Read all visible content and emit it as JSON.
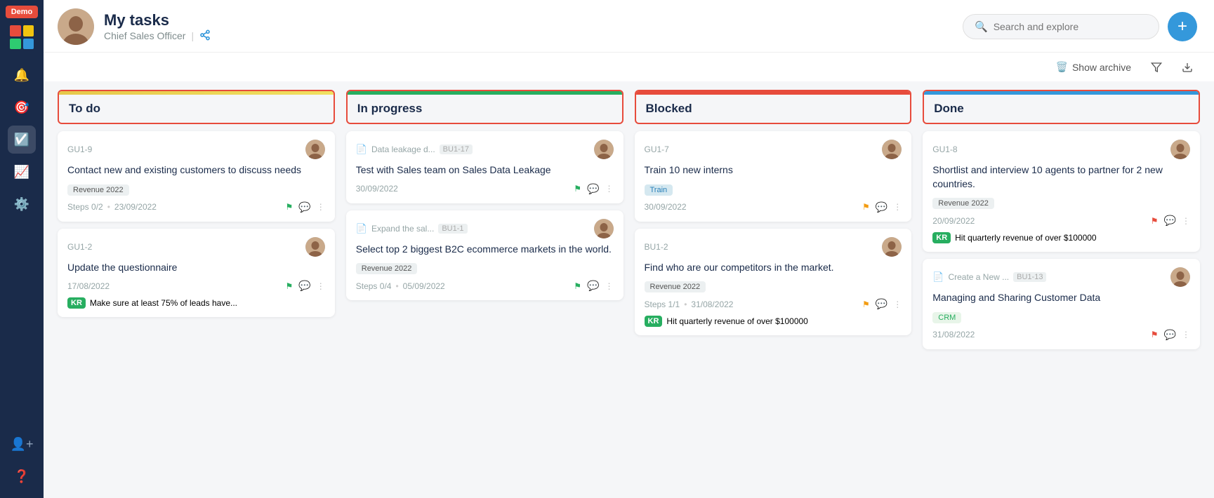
{
  "demo": {
    "label": "Demo"
  },
  "header": {
    "title": "My tasks",
    "subtitle": "Chief Sales Officer",
    "share_label": "share"
  },
  "toolbar": {
    "archive_label": "Show archive",
    "filter_label": "filter",
    "download_label": "download"
  },
  "search": {
    "placeholder": "Search and explore"
  },
  "add_btn": "+",
  "columns": [
    {
      "id": "todo",
      "title": "To do",
      "bar_class": "bar-yellow",
      "cards": [
        {
          "id": "GU1-9",
          "prefix": "",
          "mid": "",
          "title": "Contact new and existing customers to discuss needs",
          "tag": "Revenue 2022",
          "tag_class": "",
          "steps": "Steps 0/2",
          "date": "23/09/2022",
          "flag_class": "flag-green",
          "sub": null
        },
        {
          "id": "GU1-2",
          "prefix": "",
          "mid": "",
          "title": "Update the questionnaire",
          "tag": "",
          "tag_class": "",
          "steps": "",
          "date": "17/08/2022",
          "flag_class": "flag-green",
          "sub": "Make sure at least 75% of leads have..."
        }
      ]
    },
    {
      "id": "inprogress",
      "title": "In progress",
      "bar_class": "bar-green",
      "cards": [
        {
          "id": "BU1-17",
          "prefix": "Data leakage d...",
          "mid": "BU1-17",
          "title": "Test with Sales team on Sales Data Leakage",
          "tag": "",
          "tag_class": "",
          "steps": "",
          "date": "30/09/2022",
          "flag_class": "flag-green",
          "sub": null
        },
        {
          "id": "BU1-1",
          "prefix": "Expand the sal...",
          "mid": "BU1-1",
          "title": "Select top 2 biggest B2C ecommerce markets in the world.",
          "tag": "Revenue 2022",
          "tag_class": "",
          "steps": "Steps 0/4",
          "date": "05/09/2022",
          "flag_class": "flag-green",
          "sub": null
        }
      ]
    },
    {
      "id": "blocked",
      "title": "Blocked",
      "bar_class": "bar-red",
      "cards": [
        {
          "id": "GU1-7",
          "prefix": "",
          "mid": "",
          "title": "Train 10 new interns",
          "tag": "Train",
          "tag_class": "train",
          "steps": "",
          "date": "30/09/2022",
          "flag_class": "flag-yellow",
          "sub": null
        },
        {
          "id": "BU1-2",
          "prefix": "",
          "mid": "",
          "title": "Find who are our competitors in the market.",
          "tag": "Revenue 2022",
          "tag_class": "",
          "steps": "Steps 1/1",
          "date": "31/08/2022",
          "flag_class": "flag-yellow",
          "sub": "Hit quarterly revenue of over $100000"
        }
      ]
    },
    {
      "id": "done",
      "title": "Done",
      "bar_class": "bar-blue",
      "cards": [
        {
          "id": "GU1-8",
          "prefix": "",
          "mid": "",
          "title": "Shortlist and interview 10 agents to partner for 2 new countries.",
          "tag": "Revenue 2022",
          "tag_class": "",
          "steps": "",
          "date": "20/09/2022",
          "flag_class": "flag-red",
          "sub": "Hit quarterly revenue of over $100000"
        },
        {
          "id": "BU1-13",
          "prefix": "Create a New ...",
          "mid": "BU1-13",
          "title": "Managing and Sharing Customer Data",
          "tag": "CRM",
          "tag_class": "crm",
          "steps": "",
          "date": "31/08/2022",
          "flag_class": "flag-red",
          "sub": null
        }
      ]
    }
  ]
}
